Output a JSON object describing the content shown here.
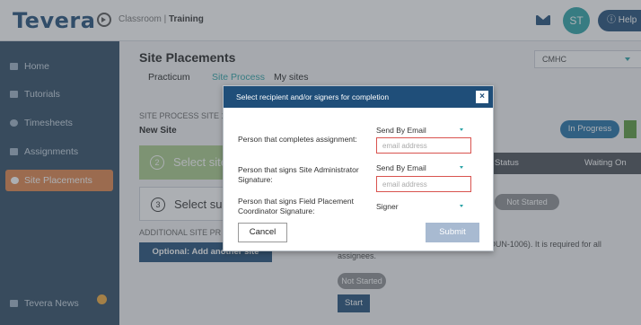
{
  "topbar": {
    "logo": "Tevera",
    "breadcrumb_root": "Classroom",
    "breadcrumb_sep": " | ",
    "breadcrumb_current": "Training",
    "avatar_initials": "ST",
    "help_label": "Help"
  },
  "sidebar": {
    "items": [
      {
        "label": "Home",
        "icon": "home-icon"
      },
      {
        "label": "Tutorials",
        "icon": "tutorials-icon"
      },
      {
        "label": "Timesheets",
        "icon": "clock-icon"
      },
      {
        "label": "Assignments",
        "icon": "folder-icon"
      },
      {
        "label": "Site Placements",
        "icon": "location-pin-icon"
      }
    ],
    "news_label": "Tevera News",
    "news_badge_color": "#f0a93b"
  },
  "main": {
    "title": "Site Placements",
    "program_select": "CMHC",
    "tabs": [
      "Practicum",
      "Site Process",
      "My sites"
    ],
    "step_label": "SITE PROCESS SITE 1",
    "new_site": "New Site",
    "in_progress": "In Progress",
    "step2_number": "2",
    "step2_label": "Select site",
    "step3_number": "3",
    "step3_label": "Select supe",
    "status_header": "Status",
    "waiting_header": "Waiting On",
    "not_started_1": "Not Started",
    "additional_label": "ADDITIONAL SITE PR",
    "optional_button": "Optional: Add another site",
    "assignment_text": "ion form - Full (Staff & Students) (UNCP-COUN-1006). It is required for all assignees.",
    "not_started_2": "Not Started",
    "start_button": "Start"
  },
  "modal": {
    "title": "Select recipient and/or signers for completion",
    "close_label": "×",
    "rows": [
      {
        "label": "Person that completes assignment:",
        "method": "Send By Email",
        "placeholder": "email address"
      },
      {
        "label": "Person that signs Site Administrator Signature:",
        "method": "Send By Email",
        "placeholder": "email address"
      },
      {
        "label": "Person that signs Field Placement Coordinator Signature:",
        "method": "Signer"
      }
    ],
    "cancel_label": "Cancel",
    "submit_label": "Submit"
  },
  "colors": {
    "brand": "#1f4e79",
    "teal": "#2aa3a6",
    "sidebar_bg": "#2c4a63",
    "active_nav": "#e0844a",
    "step_green": "#a9cd8a",
    "error_border": "#d9534f"
  }
}
